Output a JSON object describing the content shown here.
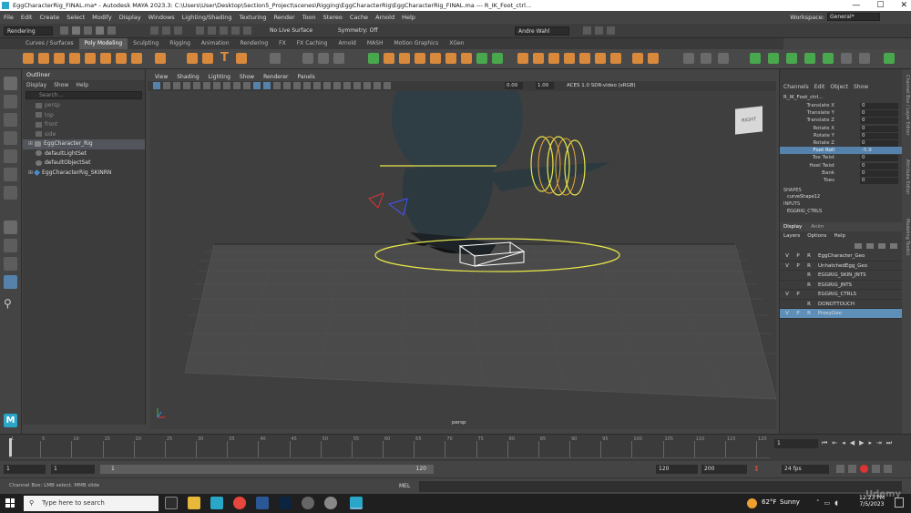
{
  "titlebar": {
    "title": "EggCharacterRig_FINAL.ma* - Autodesk MAYA 2023.3: C:\\Users\\User\\Desktop\\Section5_Project\\scenes\\Rigging\\EggCharacterRig\\EggCharacterRig_FINAL.ma  ---  R_IK_Foot_ctrl...",
    "minimize": "—",
    "maximize": "☐",
    "close": "✕"
  },
  "menubar": [
    "File",
    "Edit",
    "Create",
    "Select",
    "Modify",
    "Display",
    "Windows",
    "Lighting/Shading",
    "Texturing",
    "Render",
    "Toon",
    "Stereo",
    "Cache",
    "Arnold",
    "Help"
  ],
  "workspace": {
    "label": "Workspace:",
    "value": "General*"
  },
  "statusline": {
    "mode": "Rendering",
    "live_surface": "No Live Surface",
    "symmetry": "Symmetry: Off",
    "user": "Andre Wahl"
  },
  "shelf_tabs": [
    "Curves / Surfaces",
    "Poly Modeling",
    "Sculpting",
    "Rigging",
    "Animation",
    "Rendering",
    "FX",
    "FX Caching",
    "Arnold",
    "MASH",
    "Motion Graphics",
    "XGen"
  ],
  "shelf_active": "Poly Modeling",
  "outliner": {
    "title": "Outliner",
    "menu": [
      "Display",
      "Show",
      "Help"
    ],
    "search_placeholder": "Search...",
    "items": [
      {
        "label": "persp",
        "dim": true
      },
      {
        "label": "top",
        "dim": true
      },
      {
        "label": "front",
        "dim": true
      },
      {
        "label": "side",
        "dim": true
      },
      {
        "label": "EggCharacter_Rig",
        "dim": false,
        "selected": true
      },
      {
        "label": "defaultLightSet",
        "dim": false
      },
      {
        "label": "defaultObjectSet",
        "dim": false
      },
      {
        "label": "EggCharacterRig_SKINRN",
        "dim": false
      }
    ]
  },
  "viewport": {
    "menu": [
      "View",
      "Shading",
      "Lighting",
      "Show",
      "Renderer",
      "Panels"
    ],
    "field1": "0.00",
    "field2": "1.00",
    "colorspace": "ACES 1.0 SDR-video (sRGB)",
    "camera_label": "persp",
    "viewcube_label": "RIGHT"
  },
  "channelbox": {
    "menu": [
      "Channels",
      "Edit",
      "Object",
      "Show"
    ],
    "object": "R_IK_Foot_ctrl...",
    "channels": [
      {
        "label": "Translate X",
        "value": "0"
      },
      {
        "label": "Translate Y",
        "value": "0"
      },
      {
        "label": "Translate Z",
        "value": "0"
      },
      {
        "label": "Rotate X",
        "value": "0"
      },
      {
        "label": "Rotate Y",
        "value": "0"
      },
      {
        "label": "Rotate Z",
        "value": "0"
      },
      {
        "label": "Foot Roll",
        "value": "-5.9",
        "highlight": true
      },
      {
        "label": "Toe Twist",
        "value": "0"
      },
      {
        "label": "Heel Twist",
        "value": "0"
      },
      {
        "label": "Bank",
        "value": "0"
      },
      {
        "label": "Toes",
        "value": "0"
      }
    ],
    "shapes_header": "SHAPES",
    "shape": "curveShape12",
    "inputs_header": "INPUTS",
    "input": "EGGRIG_CTRLS"
  },
  "layers": {
    "tabs": [
      "Display",
      "Anim"
    ],
    "menu": [
      "Layers",
      "Options",
      "Help"
    ],
    "rows": [
      {
        "v": "V",
        "p": "P",
        "r": "R",
        "name": "EggCharacter_Geo"
      },
      {
        "v": "V",
        "p": "P",
        "r": "R",
        "name": "UnhatchedEgg_Geo"
      },
      {
        "v": "",
        "p": "",
        "r": "R",
        "name": "EGGRIG_SKIN_JNTS"
      },
      {
        "v": "",
        "p": "",
        "r": "R",
        "name": "EGGRIG_JNTS"
      },
      {
        "v": "V",
        "p": "P",
        "r": "",
        "name": "EGGRIG_CTRLS"
      },
      {
        "v": "",
        "p": "",
        "r": "R",
        "name": "DONOTTOUCH"
      },
      {
        "v": "V",
        "p": "P",
        "r": "R",
        "name": "ProxyGeo",
        "selected": true
      }
    ]
  },
  "side_tabs": [
    "Channel Box / Layer Editor",
    "Attribute Editor",
    "Modeling Toolkit"
  ],
  "timeline": {
    "ticks": [
      "1",
      "5",
      "10",
      "15",
      "20",
      "25",
      "30",
      "35",
      "40",
      "45",
      "50",
      "55",
      "60",
      "65",
      "70",
      "75",
      "80",
      "85",
      "90",
      "95",
      "100",
      "105",
      "110",
      "115",
      "120"
    ],
    "current_frame": "1"
  },
  "range": {
    "start": "1",
    "start_inner": "1",
    "slider_start": "1",
    "slider_end": "120",
    "end_inner": "120",
    "end": "200",
    "fps": "24 fps"
  },
  "commandline": {
    "lang": "MEL",
    "help": "Channel Box: LMB select. MMB slide"
  },
  "taskbar": {
    "search": "Type here to search",
    "weather_temp": "62°F",
    "weather_text": "Sunny",
    "time": "12:23 PM",
    "date": "7/5/2023"
  },
  "watermark": "Udemy",
  "colors": {
    "accent": "#5582aa",
    "yellow": "#e8e84a",
    "green_icon": "#49a84d",
    "orange_icon": "#e08a3a"
  }
}
